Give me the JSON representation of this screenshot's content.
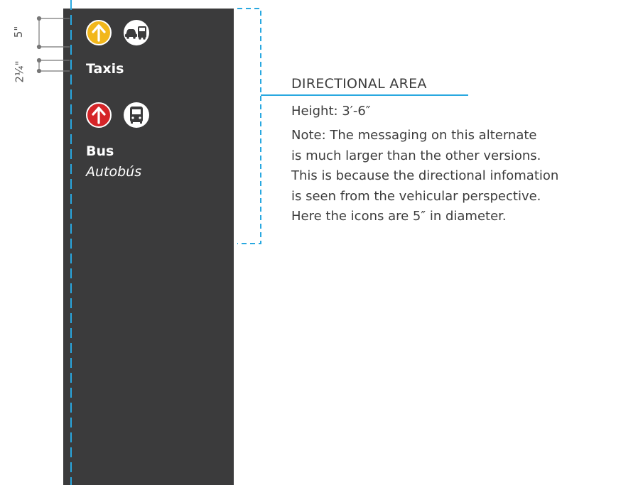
{
  "colors": {
    "sign_background": "#3b3b3c",
    "dimension_line": "#29a8e0",
    "taxi_arrow_circle": "#f2b71b",
    "bus_arrow_circle": "#d52428",
    "icon_white": "#ffffff",
    "text_dark": "#3c3c3c"
  },
  "dimensions": {
    "icon_height": "5\"",
    "spacing": "2¼\""
  },
  "sign": {
    "taxis": {
      "arrow_icon": "up-arrow-icon",
      "mode_icon": "taxi-car-icon",
      "label": "Taxis"
    },
    "bus": {
      "arrow_icon": "up-arrow-icon",
      "mode_icon": "bus-icon",
      "label": "Bus",
      "label_spanish": "Autobús"
    }
  },
  "callout": {
    "title": "DIRECTIONAL AREA",
    "height": "Height: 3′-6″",
    "note_lines": [
      "Note: The messaging on this alternate",
      "is much larger than the other versions.",
      "This is because the directional infomation",
      "is seen from the vehicular perspective.",
      "Here the icons are 5″ in diameter."
    ]
  }
}
